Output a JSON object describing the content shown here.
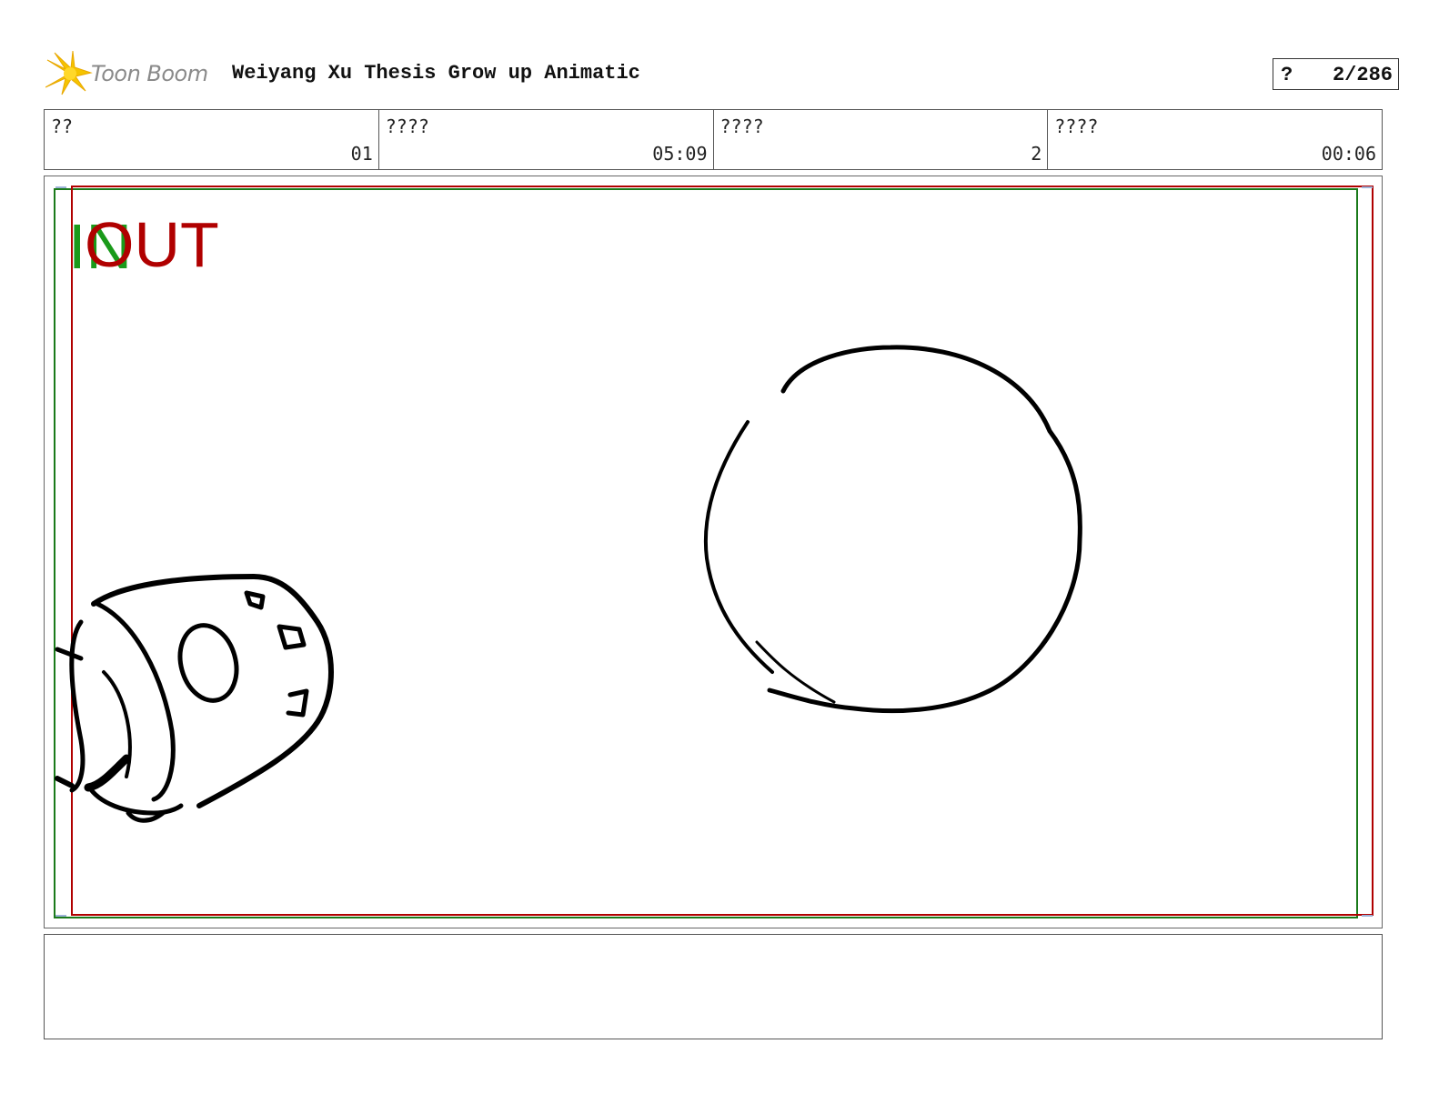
{
  "header": {
    "logo_text": "Toon Boom",
    "project_title": "Weiyang Xu Thesis Grow up Animatic",
    "page_label": "?",
    "page_number": "2/286"
  },
  "info": [
    {
      "label": "??",
      "value": "01"
    },
    {
      "label": "????",
      "value": "05:09"
    },
    {
      "label": "????",
      "value": "2"
    },
    {
      "label": "????",
      "value": "00:06"
    }
  ],
  "panel": {
    "in_marker": "IN",
    "out_marker": "OUT",
    "colors": {
      "in": "#1a9a1a",
      "out": "#b00000",
      "sketch": "#000000"
    }
  },
  "caption": {
    "text": ""
  }
}
